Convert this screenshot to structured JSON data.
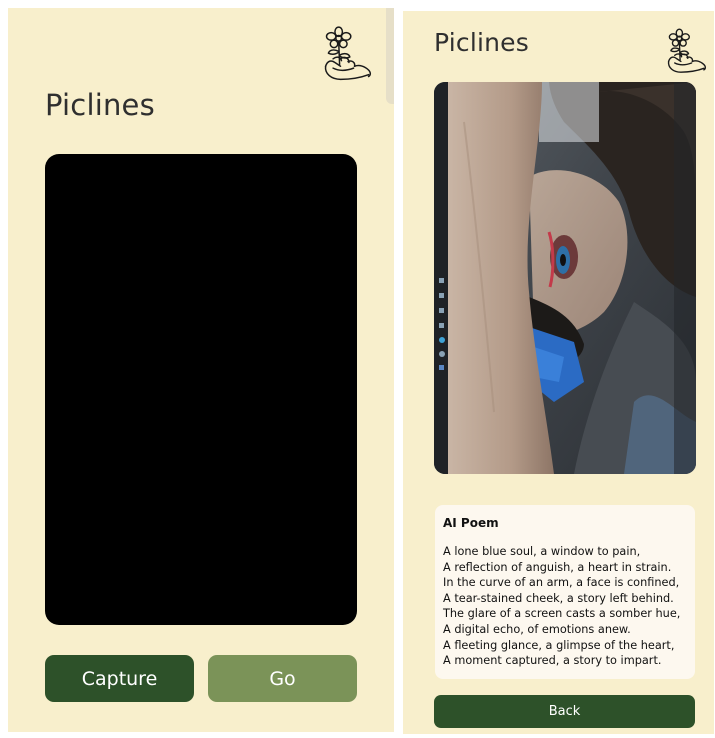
{
  "capture_screen": {
    "title": "Piclines",
    "logo_icon": "hand-holding-flower-icon",
    "capture_label": "Capture",
    "go_label": "Go"
  },
  "result_screen": {
    "title": "Piclines",
    "logo_icon": "hand-holding-flower-icon",
    "photo_icon": "captured-photo",
    "poem_heading": "AI Poem",
    "poem_lines": [
      "A lone blue soul, a window to pain,",
      "A reflection of anguish, a heart in strain.",
      "In the curve of an arm, a face is confined,",
      "A tear-stained cheek, a story left behind.",
      "The glare of a screen casts a somber hue,",
      "A digital echo, of emotions anew.",
      "A fleeting glance, a glimpse of the heart,",
      "A moment captured, a story to impart."
    ],
    "back_label": "Back"
  },
  "colors": {
    "background": "#f8efcc",
    "primary_button": "#2d5129",
    "secondary_button": "#7b9358",
    "poem_card": "#fdf8ef",
    "camera_view": "#000000"
  }
}
